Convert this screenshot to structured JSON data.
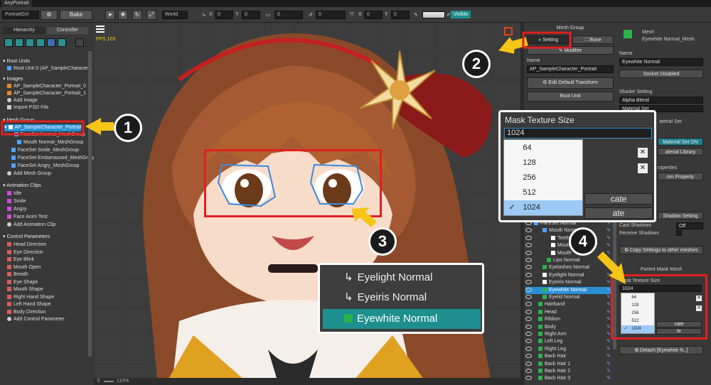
{
  "window": {
    "title": "AnyPortrait"
  },
  "toolbar": {
    "portrait": "PortraitGirl",
    "bake": "Bake",
    "space": "World",
    "pos_x_lbl": "X",
    "pos_x": "0",
    "pos_y_lbl": "Y",
    "pos_y": "0",
    "depth": "0",
    "rot": "0",
    "scale_x_lbl": "X",
    "scale_x": "0",
    "scale_y_lbl": "Y",
    "scale_y": "0",
    "visible": "Visible"
  },
  "left": {
    "tab_hierarchy": "Hierarchy",
    "tab_controller": "Controller",
    "root_units_hdr": "Root Units",
    "root_unit": "Root Unit 0 (AP_SampleCharacter_",
    "images_hdr": "Images",
    "image1": "AP_SampleCharacter_Portrait_0",
    "image2": "AP_SampleCharacter_Portrait_1",
    "add_image": "Add Image",
    "import_psd": "Import PSD File",
    "meshgroup_hdr": "Mesh Group",
    "mg_items": [
      "AP_SampleCharacter_Portrait",
      "FaceSet Normal_MeshGroup",
      "Mouth Normal_MeshGroup",
      "FaceSet Smile_MeshGroup",
      "FaceSet Embarrassed_MeshGroup",
      "FaceSet Angry_MeshGroup",
      "Add Mesh Group"
    ],
    "anim_hdr": "Animation Clips",
    "anim_items": [
      "Idle",
      "Smile",
      "Angry",
      "Face Anim Test",
      "Add Animation Clip"
    ],
    "param_hdr": "Control Parameters",
    "param_items": [
      "Head Direction",
      "Eye Direction",
      "Eye Blink",
      "Mouth Open",
      "Breath",
      "Eye Shape",
      "Mouth Shape",
      "Right Hand Shape",
      "Left Hand Shape",
      "Body Direction",
      "Add Control Parameter"
    ]
  },
  "canvas": {
    "fps": "FPS 103",
    "zoom": "110%"
  },
  "meshgroup": {
    "header": "Mesh Group",
    "setting": "Setting",
    "bone": "Bone",
    "modifier": "Modifier",
    "name_lbl": "Name",
    "name_val": "AP_SampleCharacter_Portrait",
    "edit_default": "Edit Default Transform",
    "root_unit": "Root Unit",
    "layers": [
      "FaceSet Normal",
      "Mouth Normal",
      "Teeth",
      "Mouth",
      "Mouth",
      "Lips Normal",
      "Eyelashes Normal",
      "Eyelight Normal",
      "Eyeiris Normal",
      "Eyewhite Normal",
      "Eyelid Normal",
      "Hairband",
      "Head",
      "Ribbon",
      "Body",
      "Right Arm",
      "Left Leg",
      "Right Leg",
      "Back Hair",
      "Back Hair 1",
      "Back Hair 2",
      "Back Hair 3"
    ]
  },
  "right": {
    "type": "Mesh",
    "mesh_name": "Eyewhite Normal_Mesh",
    "name_lbl": "Name",
    "name_val": "Eyewhite Normal",
    "socket": "Socket Disabled",
    "shader_lbl": "Shader Setting",
    "shader_val": "Alpha Blend",
    "material_set": "Material Set",
    "material_lbl": "aterial Set",
    "material_on": "Material Set ON",
    "material_lib": "aterial Library",
    "properties": "roperties",
    "custom_prop": "om Property",
    "shadow_btn": "Shadow Setting",
    "cast_shadows": "Cast Shadows",
    "cast_val": "Off",
    "receive_shadows": "Receive Shadows",
    "copy_btn": "Copy Settings to other meshes",
    "parent_mask": "Parent Mask Mesh",
    "mask_lbl": "Mask Texture Size",
    "mask_val": "1024",
    "mask_options": [
      "64",
      "128",
      "256",
      "512",
      "1024"
    ],
    "cate": "cate",
    "te": "te",
    "detach": "Detach [Eyewhite N..]"
  },
  "zoom_popup": {
    "title": "Mask Texture Size",
    "value": "1024",
    "options": [
      "64",
      "128",
      "256",
      "512",
      "1024"
    ],
    "cate": "cate",
    "ate": "ate"
  },
  "layer_popup": {
    "items": [
      "Eyelight Normal",
      "Eyeiris Normal",
      "Eyewhite Normal"
    ]
  },
  "callouts": [
    "1",
    "2",
    "3",
    "4"
  ],
  "colors": {
    "accent": "#2b8fd6",
    "highlight": "#e02020",
    "arrow": "#f5c518",
    "teal": "#1e8f8f"
  }
}
